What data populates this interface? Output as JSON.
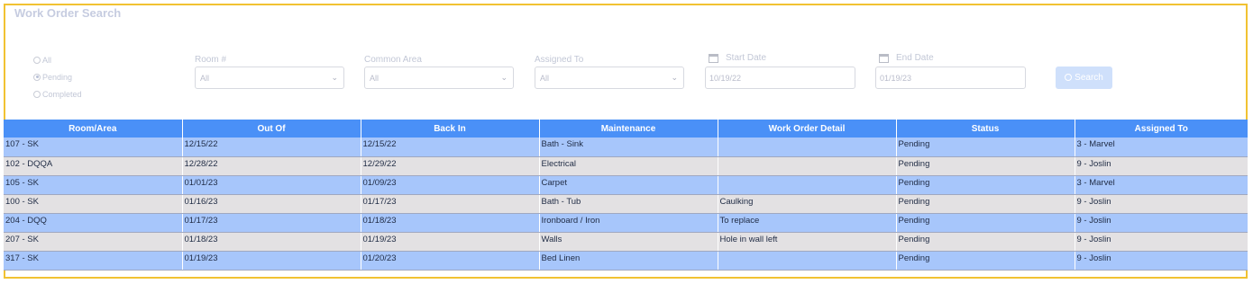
{
  "page_title": "Work Order Search",
  "filters": {
    "status_options": [
      {
        "label": "All",
        "checked": false
      },
      {
        "label": "Pending",
        "checked": true
      },
      {
        "label": "Completed",
        "checked": false
      }
    ],
    "room": {
      "label": "Room #",
      "value": "All"
    },
    "common_area": {
      "label": "Common Area",
      "value": "All"
    },
    "assigned_to": {
      "label": "Assigned To",
      "value": "All"
    },
    "start_date": {
      "label": "Start Date",
      "value": "10/19/22"
    },
    "end_date": {
      "label": "End Date",
      "value": "01/19/23"
    },
    "search_label": "Search"
  },
  "table": {
    "columns": [
      "Room/Area",
      "Out Of",
      "Back In",
      "Maintenance",
      "Work Order Detail",
      "Status",
      "Assigned To"
    ],
    "rows": [
      [
        "107 - SK",
        "12/15/22",
        "12/15/22",
        "Bath - Sink",
        "",
        "Pending",
        "3 - Marvel"
      ],
      [
        "102 - DQQA",
        "12/28/22",
        "12/29/22",
        "Electrical",
        "",
        "Pending",
        "9 - Joslin"
      ],
      [
        "105 - SK",
        "01/01/23",
        "01/09/23",
        "Carpet",
        "",
        "Pending",
        "3 - Marvel"
      ],
      [
        "100 - SK",
        "01/16/23",
        "01/17/23",
        "Bath - Tub",
        "Caulking",
        "Pending",
        "9 - Joslin"
      ],
      [
        "204 - DQQ",
        "01/17/23",
        "01/18/23",
        "Ironboard / Iron",
        "To replace",
        "Pending",
        "9 - Joslin"
      ],
      [
        "207 - SK",
        "01/18/23",
        "01/19/23",
        "Walls",
        "Hole in wall left",
        "Pending",
        "9 - Joslin"
      ],
      [
        "317 - SK",
        "01/19/23",
        "01/20/23",
        "Bed Linen",
        "",
        "Pending",
        "9 - Joslin"
      ]
    ]
  },
  "colors": {
    "header_bg": "#4a90f7",
    "row_odd_bg": "#a7c6fb",
    "row_even_bg": "#e3e1e3",
    "frame_border": "#f1c232"
  }
}
